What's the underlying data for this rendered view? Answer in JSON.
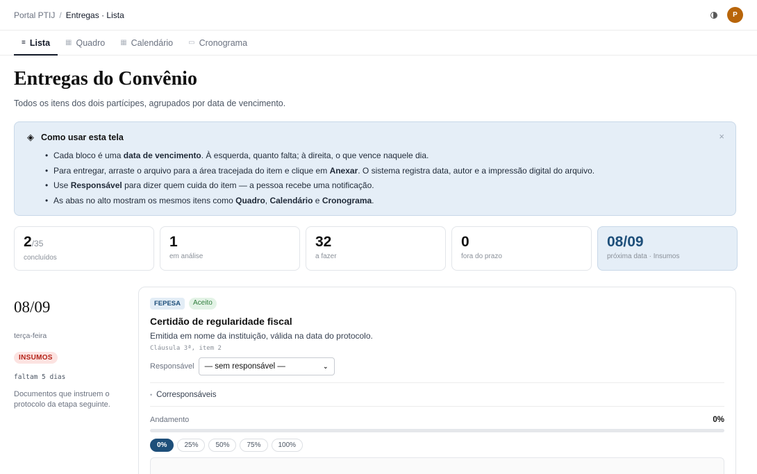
{
  "breadcrumb": {
    "root": "Portal PTIJ",
    "separator": "/",
    "current": "Entregas · Lista"
  },
  "user": {
    "initial": "P",
    "avatar_color": "#b8650a"
  },
  "tabs": [
    {
      "label": "Lista",
      "icon": "≡",
      "active": true
    },
    {
      "label": "Quadro",
      "icon": "▦",
      "active": false
    },
    {
      "label": "Calendário",
      "icon": "▦",
      "active": false
    },
    {
      "label": "Cronograma",
      "icon": "▭",
      "active": false
    }
  ],
  "page": {
    "title": "Entregas do Convênio",
    "subtitle": "Todos os itens dos dois partícipes, agrupados por data de vencimento."
  },
  "help": {
    "title": "Como usar esta tela",
    "close": "×",
    "items": [
      {
        "a": "Cada bloco é uma ",
        "b": "data de vencimento",
        "c": ". À esquerda, quanto falta; à direita, o que vence naquele dia."
      },
      {
        "a": "Para entregar, arraste o arquivo para a área tracejada do item e clique em ",
        "b": "Anexar",
        "c": ". O sistema registra data, autor e a impressão digital do arquivo."
      },
      {
        "a": "Use ",
        "b": "Responsável",
        "c": " para dizer quem cuida do item — a pessoa recebe uma notificação."
      },
      {
        "a": "As abas no alto mostram os mesmos itens como ",
        "b": "Quadro",
        "c": ", ",
        "d": "Calendário",
        "e": " e ",
        "f": "Cronograma",
        "g": "."
      }
    ]
  },
  "stats": [
    {
      "value": "2",
      "of": "/35",
      "label": "concluídos"
    },
    {
      "value": "1",
      "of": "",
      "label": "em análise"
    },
    {
      "value": "32",
      "of": "",
      "label": "a fazer"
    },
    {
      "value": "0",
      "of": "",
      "label": "fora do prazo"
    },
    {
      "value": "08/09",
      "of": "",
      "label": "próxima data · Insumos"
    }
  ],
  "group": {
    "date": "08/09",
    "weekday": "terça-feira",
    "badge": "INSUMOS",
    "countdown": "faltam 5 dias",
    "description": "Documentos que instruem o protocolo da etapa seguinte."
  },
  "item": {
    "org": "FEPESA",
    "status": "Aceito",
    "title": "Certidão de regularidade fiscal",
    "description": "Emitida em nome da instituição, válida na data do protocolo.",
    "clause": "Cláusula 3ª, item 2",
    "responsavel_label": "Responsável",
    "responsavel_value": "— sem responsável —",
    "coresp_label": "Corresponsáveis",
    "andamento_label": "Andamento",
    "andamento_value": "0%",
    "progress": 0,
    "pct_options": [
      "0%",
      "25%",
      "50%",
      "75%",
      "100%"
    ]
  },
  "colors": {
    "accent": "#1e4f7a",
    "info_bg": "#e5eef7",
    "danger": "#b42318",
    "success": "#2f7d3c"
  }
}
